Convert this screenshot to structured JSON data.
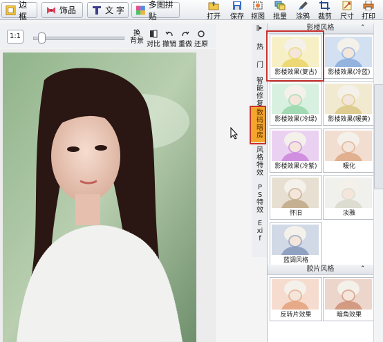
{
  "toolbar": {
    "left_buttons": [
      {
        "label": "边 框",
        "icon": "frame-icon"
      },
      {
        "label": "饰品",
        "icon": "ribbon-icon"
      },
      {
        "label": "文 字",
        "icon": "text-icon"
      },
      {
        "label": "多图拼贴",
        "icon": "collage-icon"
      }
    ],
    "right_tools": [
      {
        "label": "打开",
        "icon": "open-icon"
      },
      {
        "label": "保存",
        "icon": "save-icon"
      },
      {
        "label": "抠图",
        "icon": "cutout-icon"
      },
      {
        "label": "批量",
        "icon": "batch-icon"
      },
      {
        "label": "涂鸦",
        "icon": "brush-icon"
      },
      {
        "label": "裁剪",
        "icon": "crop-icon"
      },
      {
        "label": "尺寸",
        "icon": "resize-icon"
      },
      {
        "label": "打印",
        "icon": "print-icon"
      }
    ]
  },
  "subbar": {
    "ratio_label": "1:1",
    "zoom_level": 0.05,
    "buttons": [
      {
        "label": "换\n背景",
        "icon": "swap-background-icon"
      },
      {
        "label": "对比",
        "icon": "compare-icon"
      },
      {
        "label": "撤销",
        "icon": "undo-icon"
      },
      {
        "label": "重做",
        "icon": "redo-icon"
      },
      {
        "label": "还原",
        "icon": "restore-icon"
      }
    ]
  },
  "sidenav": {
    "collapse_glyph": "‖▸",
    "tabs": [
      "热门",
      "智能修复",
      "数码暗房",
      "风格特效",
      "PS特效",
      "Exif"
    ],
    "active": "数码暗房"
  },
  "panel": {
    "section1_title": "影楼风格",
    "section1_items": [
      {
        "caption": "影楼效果(复古)",
        "tint": "#e8d25a"
      },
      {
        "caption": "影楼效果(冷蓝)",
        "tint": "#7fa6d8"
      },
      {
        "caption": "影楼效果(冷绿)",
        "tint": "#8fd3a4"
      },
      {
        "caption": "影楼效果(暖黄)",
        "tint": "#d8c27a"
      },
      {
        "caption": "影楼效果(冷紫)",
        "tint": "#c77ad8"
      },
      {
        "caption": "暖化",
        "tint": "#d9a07a"
      },
      {
        "caption": "怀旧",
        "tint": "#b9a27c"
      },
      {
        "caption": "淡雅",
        "tint": "#d5d5c8"
      },
      {
        "caption": "蓝调风格",
        "tint": "#7a8fb6"
      }
    ],
    "section2_title": "胶片风格",
    "section2_items": [
      {
        "caption": "反转片效果",
        "tint": "#e29a72"
      },
      {
        "caption": "暗角效果",
        "tint": "#c9876a"
      }
    ]
  }
}
